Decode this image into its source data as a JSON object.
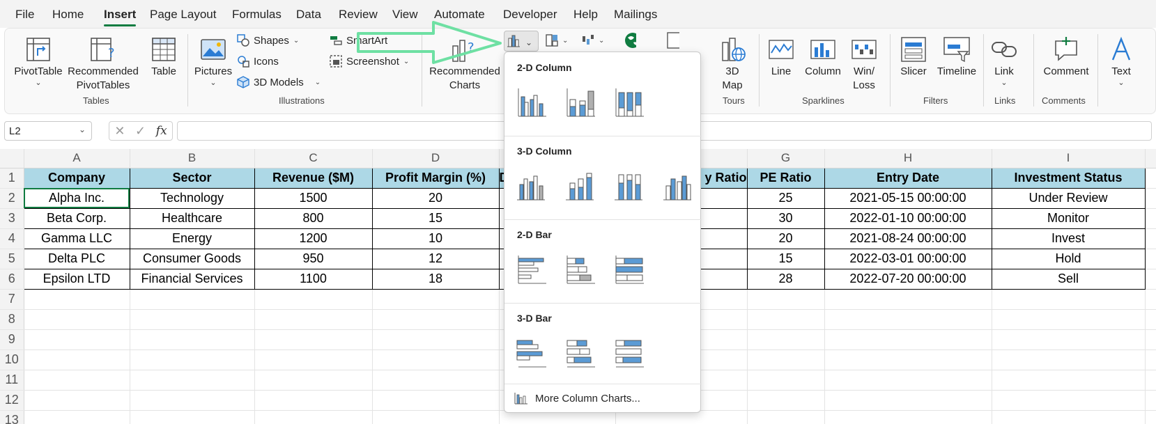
{
  "menu": {
    "tabs": [
      "File",
      "Home",
      "Insert",
      "Page Layout",
      "Formulas",
      "Data",
      "Review",
      "View",
      "Automate",
      "Developer",
      "Help",
      "Mailings"
    ],
    "active": "Insert"
  },
  "ribbon": {
    "tables": {
      "pivot": "PivotTable",
      "rec_pivot_1": "Recommended",
      "rec_pivot_2": "PivotTables",
      "table": "Table",
      "group": "Tables"
    },
    "illustrations": {
      "pictures": "Pictures",
      "shapes": "Shapes",
      "icons": "Icons",
      "models": "3D Models",
      "smartart": "SmartArt",
      "screenshot": "Screenshot",
      "group": "Illustrations"
    },
    "charts": {
      "rec_1": "Recommended",
      "rec_2": "Charts"
    },
    "tours": {
      "map_1": "3D",
      "map_2": "Map",
      "group": "Tours"
    },
    "sparklines": {
      "line": "Line",
      "column": "Column",
      "winloss_1": "Win/",
      "winloss_2": "Loss",
      "group": "Sparklines"
    },
    "filters": {
      "slicer": "Slicer",
      "timeline": "Timeline",
      "group": "Filters"
    },
    "links": {
      "link": "Link",
      "group": "Links"
    },
    "comments": {
      "comment": "Comment",
      "group": "Comments"
    },
    "text": {
      "text": "Text"
    }
  },
  "formula_bar": {
    "name_box": "L2",
    "fx": "fx",
    "formula": ""
  },
  "columns": [
    "A",
    "B",
    "C",
    "D",
    "E",
    "F",
    "G",
    "H",
    "I"
  ],
  "rows": [
    "1",
    "2",
    "3",
    "4",
    "5",
    "6",
    "7",
    "8",
    "9",
    "10",
    "11",
    "12",
    "13"
  ],
  "table": {
    "headers": [
      "Company",
      "Sector",
      "Revenue ($M)",
      "Profit Margin (%)",
      "D",
      "y Ratio",
      "PE Ratio",
      "Entry Date",
      "Investment Status"
    ],
    "rows": [
      [
        "Alpha Inc.",
        "Technology",
        "1500",
        "20",
        "",
        "",
        "25",
        "2021-05-15 00:00:00",
        "Under Review"
      ],
      [
        "Beta Corp.",
        "Healthcare",
        "800",
        "15",
        "",
        "",
        "30",
        "2022-01-10 00:00:00",
        "Monitor"
      ],
      [
        "Gamma LLC",
        "Energy",
        "1200",
        "10",
        "",
        "",
        "20",
        "2021-08-24 00:00:00",
        "Invest"
      ],
      [
        "Delta PLC",
        "Consumer Goods",
        "950",
        "12",
        "",
        "",
        "15",
        "2022-03-01 00:00:00",
        "Hold"
      ],
      [
        "Epsilon LTD",
        "Financial Services",
        "1100",
        "18",
        "",
        "",
        "28",
        "2022-07-20 00:00:00",
        "Sell"
      ]
    ]
  },
  "dropdown": {
    "sections": [
      "2-D Column",
      "3-D Column",
      "2-D Bar",
      "3-D Bar"
    ],
    "more": "More Column Charts..."
  },
  "colors": {
    "accent": "#107c41",
    "header_fill": "#add8e6",
    "chart_blue": "#5b9bd5",
    "arrow": "#6ee0a3"
  }
}
